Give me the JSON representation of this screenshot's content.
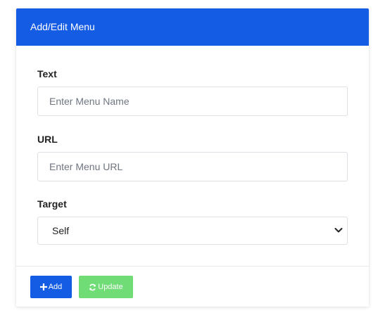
{
  "header": {
    "title": "Add/Edit Menu"
  },
  "form": {
    "text_label": "Text",
    "text_placeholder": "Enter Menu Name",
    "url_label": "URL",
    "url_placeholder": "Enter Menu URL",
    "target_label": "Target",
    "target_value": "Self"
  },
  "footer": {
    "add_label": "Add",
    "update_label": "Update",
    "add_icon": "plus-icon",
    "update_icon": "refresh-icon"
  },
  "colors": {
    "primary": "#155ce4",
    "success": "#6fdc76"
  }
}
